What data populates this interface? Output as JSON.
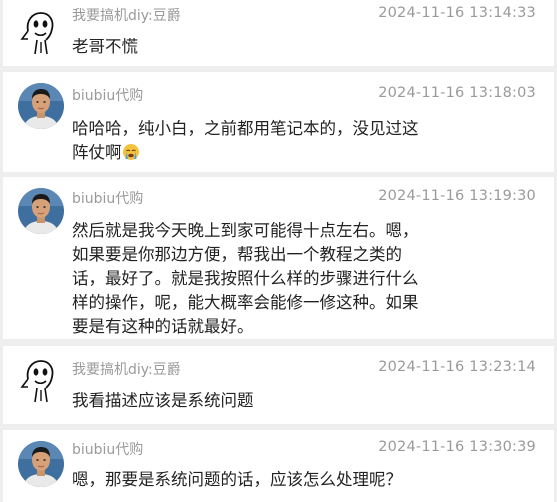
{
  "messages": [
    {
      "sender": "我要搞机diy:豆爵",
      "avatar": "doodle-face-icon",
      "time": "2024-11-16 13:14:33",
      "lines": [
        "老哥不慌"
      ]
    },
    {
      "sender": "biubiu代购",
      "avatar": "man-photo-avatar",
      "time": "2024-11-16 13:18:03",
      "lines": [
        "哈哈哈，纯小白，之前都用笔记本的，没见过这",
        "阵仗啊"
      ],
      "emoji": "crying-face-icon"
    },
    {
      "sender": "biubiu代购",
      "avatar": "man-photo-avatar",
      "time": "2024-11-16 13:19:30",
      "lines": [
        "然后就是我今天晚上到家可能得十点左右。嗯，",
        "如果要是你那边方便，帮我出一个教程之类的",
        "话，最好了。就是我按照什么样的步骤进行什么",
        "样的操作，呢，能大概率会能修一修这种。如果",
        "要是有这种的话就最好。"
      ]
    },
    {
      "sender": "我要搞机diy:豆爵",
      "avatar": "doodle-face-icon",
      "time": "2024-11-16 13:23:14",
      "lines": [
        "我看描述应该是系统问题"
      ]
    },
    {
      "sender": "biubiu代购",
      "avatar": "man-photo-avatar",
      "time": "2024-11-16 13:30:39",
      "lines": [
        "嗯，那要是系统问题的话，应该怎么处理呢？"
      ]
    }
  ]
}
